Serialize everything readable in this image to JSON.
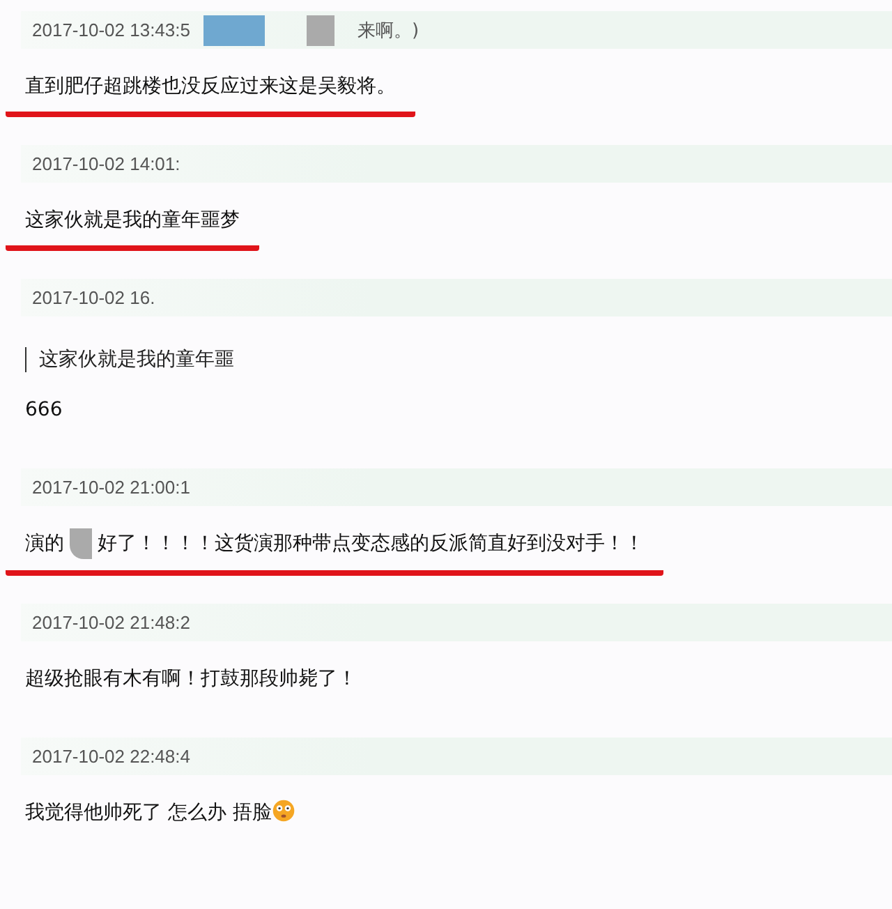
{
  "comments": [
    {
      "time": "2017-10-02 13:43:5",
      "header_tail": "来啊。)",
      "body": [
        "直到肥仔超跳楼也没反应过来这是吴毅将。"
      ],
      "underlined": true
    },
    {
      "time": "2017-10-02 14:01:",
      "body": [
        "这家伙就是我的童年噩梦"
      ],
      "underlined": true
    },
    {
      "time": "2017-10-02 16.",
      "quote": "这家伙就是我的童年噩",
      "body": [
        "666"
      ],
      "underlined": false
    },
    {
      "time": "2017-10-02 21:00:1",
      "body": [
        "演的",
        "好了！！！！这货演那种带点变态感的反派简直好到没对手！！"
      ],
      "underlined": true
    },
    {
      "time": "2017-10-02 21:48:2",
      "body": [
        "超级抢眼有木有啊！打鼓那段帅毙了！"
      ],
      "underlined": false
    },
    {
      "time": "2017-10-02 22:48:4",
      "body": [
        "我觉得他帅死了 怎么办 捂脸"
      ],
      "emoji": true,
      "underlined": false
    }
  ]
}
